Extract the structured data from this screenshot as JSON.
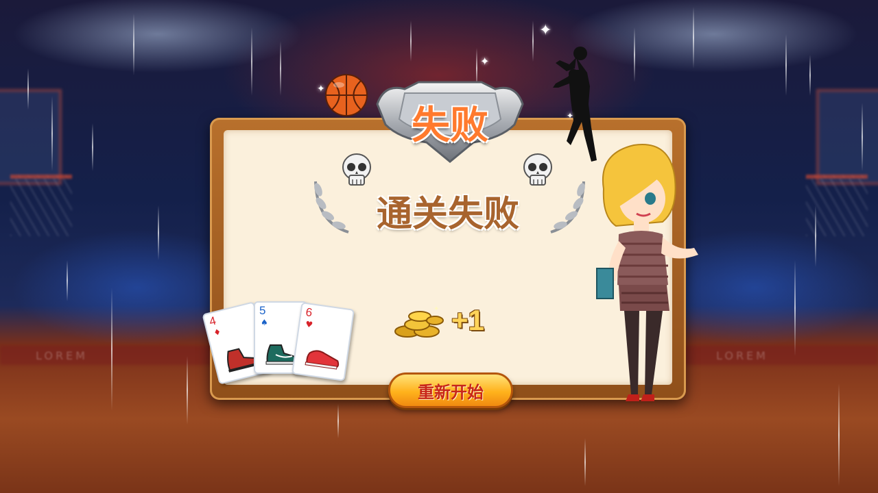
{
  "screen": {
    "header_title": "失败",
    "result_title": "通关失败",
    "reward": {
      "icon": "gold-coins-icon",
      "amount_text": "+1"
    },
    "restart_button_label": "重新开始",
    "cards": [
      {
        "rank": "4",
        "suit": "♦",
        "suit_color": "#d8232a",
        "shoe_color": "#c0302a",
        "shoe_name": "red-black-sneaker-icon"
      },
      {
        "rank": "5",
        "suit": "♠",
        "suit_color": "#1a62c8",
        "shoe_color": "#1d6b5e",
        "shoe_name": "teal-sneaker-icon"
      },
      {
        "rank": "6",
        "suit": "♥",
        "suit_color": "#d8232a",
        "shoe_color": "#e2343a",
        "shoe_name": "red-sneaker-icon"
      }
    ],
    "background_banner_text": "LOREM",
    "colors": {
      "title_orange": "#ff7a2e",
      "result_brown": "#a8642e",
      "button_gold": "#ffb21c",
      "button_text_red": "#c8261a"
    }
  }
}
